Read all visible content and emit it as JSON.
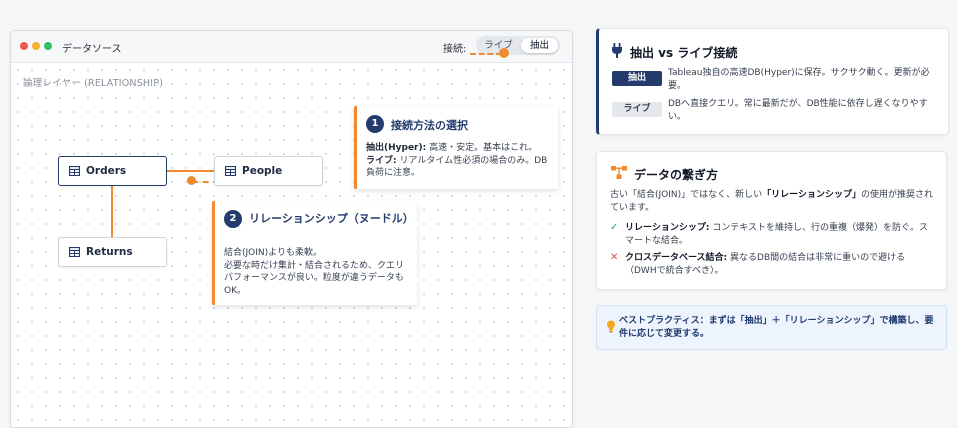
{
  "window": {
    "title": "データソース",
    "connection_label": "接続:",
    "toggle": {
      "live": "ライブ",
      "extract": "抽出",
      "selected": "抽出"
    }
  },
  "canvas": {
    "layer_label": "論理レイヤー (RELATIONSHIP)",
    "tables": {
      "orders": "Orders",
      "people": "People",
      "returns": "Returns"
    }
  },
  "callouts": {
    "c1": {
      "number": "1",
      "title": "接続方法の選択",
      "line1_bold": "抽出(Hyper):",
      "line1": " 高速・安定。基本はこれ。",
      "line2_bold": "ライブ:",
      "line2": " リアルタイム性必須の場合のみ。DB負荷に注意。"
    },
    "c2": {
      "number": "2",
      "title": "リレーションシップ（ヌードル）",
      "body1": "結合(JOIN)よりも柔軟。",
      "body2": "必要な時だけ集計・結合されるため、クエリパフォーマンスが良い。粒度が違うデータもOK。"
    }
  },
  "card_connection": {
    "title": "抽出 vs ライブ接続",
    "icon": "plug-icon",
    "extract_badge": "抽出",
    "extract_desc": "Tableau独自の高速DB(Hyper)に保存。サクサク動く。更新が必要。",
    "live_badge": "ライブ",
    "live_desc": "DBへ直接クエリ。常に最新だが、DB性能に依存し遅くなりやすい。"
  },
  "card_relation": {
    "title": "データの繋ぎ方",
    "icon": "diagram-icon",
    "intro_pre": "古い「結合(JOIN)」ではなく、新しい",
    "intro_bold": "「リレーションシップ」",
    "intro_post": "の使用が推奨されています。",
    "bullet1_mark": "✓",
    "bullet1_bold": "リレーションシップ:",
    "bullet1": " コンテキストを維持し、行の重複（爆発）を防ぐ。スマートな結合。",
    "bullet2_mark": "✕",
    "bullet2_bold": "クロスデータベース結合:",
    "bullet2": " 異なるDB間の結合は非常に重いので避ける（DWHで統合すべき）。"
  },
  "tip": {
    "icon": "lightbulb-icon",
    "text": "ベストプラクティス：まずは「抽出」＋「リレーションシップ」で構築し、要件に応じて変更する。"
  },
  "colors": {
    "accent": "#ef8a2e",
    "navy": "#243b6e",
    "close": "#ef5a4e",
    "minimize": "#f6b32c",
    "maximize": "#2fc167"
  }
}
